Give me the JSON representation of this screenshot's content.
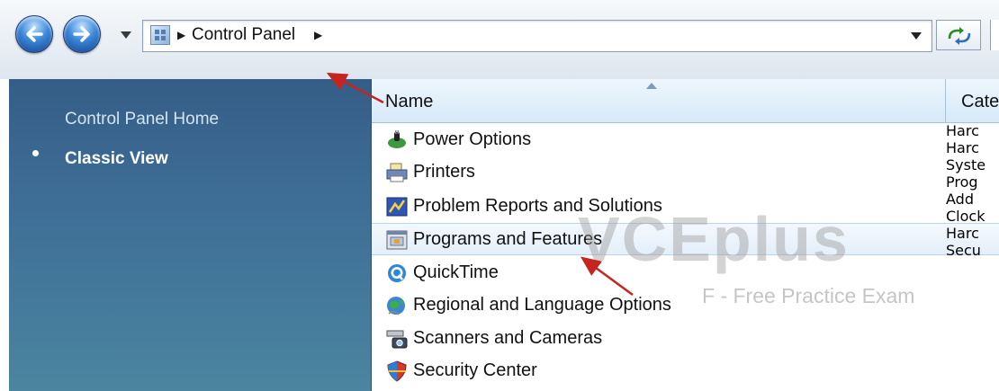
{
  "address": {
    "crumb": "Control Panel",
    "icon": "control-panel-icon"
  },
  "taskpane": {
    "home_link": "Control Panel Home",
    "classic_view": "Classic View"
  },
  "list": {
    "columns": [
      "Name",
      "Cate"
    ],
    "rows": [
      {
        "name": "Power Options",
        "cat": "Harc",
        "icon": "power-options-icon"
      },
      {
        "name": "Printers",
        "cat": "Harc",
        "icon": "printers-icon"
      },
      {
        "name": "Problem Reports and Solutions",
        "cat": "Syste",
        "icon": "problem-reports-icon"
      },
      {
        "name": "Programs and Features",
        "cat": "Prog",
        "icon": "programs-features-icon"
      },
      {
        "name": "QuickTime",
        "cat": "Add",
        "icon": "quicktime-icon"
      },
      {
        "name": "Regional and Language Options",
        "cat": "Clock",
        "icon": "regional-language-icon"
      },
      {
        "name": "Scanners and Cameras",
        "cat": "Harc",
        "icon": "scanners-cameras-icon"
      },
      {
        "name": "Security Center",
        "cat": "Secu",
        "icon": "security-center-icon"
      }
    ],
    "selected_index": 3
  },
  "watermark": {
    "logo_text": "VCEplus",
    "subtitle": "F - Free Practice Exam"
  },
  "colors": {
    "pane_top": "#355d86",
    "pane_bottom": "#4b859f",
    "annotation_arrow": "#c8241f"
  }
}
